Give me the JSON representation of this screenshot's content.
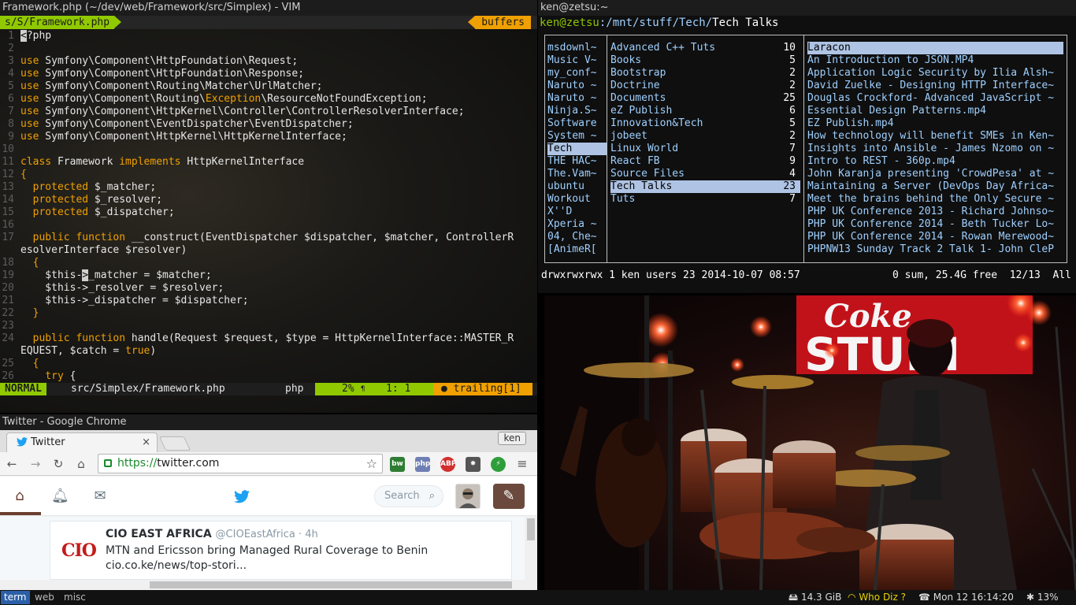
{
  "vim": {
    "title": "Framework.php (~/dev/web/Framework/src/Simplex) - VIM",
    "tab": "s/S/Framework.php",
    "buffers": "buffers",
    "lines": [
      {
        "n": "1",
        "t": "<?php"
      },
      {
        "n": "2",
        "t": ""
      },
      {
        "n": "3",
        "t": "use Symfony\\Component\\HttpFoundation\\Request;"
      },
      {
        "n": "4",
        "t": "use Symfony\\Component\\HttpFoundation\\Response;"
      },
      {
        "n": "5",
        "t": "use Symfony\\Component\\Routing\\Matcher\\UrlMatcher;"
      },
      {
        "n": "6",
        "t": "use Symfony\\Component\\Routing\\Exception\\ResourceNotFoundException;"
      },
      {
        "n": "7",
        "t": "use Symfony\\Component\\HttpKernel\\Controller\\ControllerResolverInterface;"
      },
      {
        "n": "8",
        "t": "use Symfony\\Component\\EventDispatcher\\EventDispatcher;"
      },
      {
        "n": "9",
        "t": "use Symfony\\Component\\HttpKernel\\HttpKernelInterface;"
      },
      {
        "n": "10",
        "t": ""
      },
      {
        "n": "11",
        "t": "class Framework implements HttpKernelInterface"
      },
      {
        "n": "12",
        "t": "{"
      },
      {
        "n": "13",
        "t": "  protected $_matcher;"
      },
      {
        "n": "14",
        "t": "  protected $_resolver;"
      },
      {
        "n": "15",
        "t": "  protected $_dispatcher;"
      },
      {
        "n": "16",
        "t": ""
      },
      {
        "n": "17",
        "t": "  public function __construct(EventDispatcher $dispatcher, $matcher, ControllerR"
      },
      {
        "n": "",
        "t": "esolverInterface $resolver)"
      },
      {
        "n": "18",
        "t": "  {"
      },
      {
        "n": "19",
        "t": "    $this->_matcher = $matcher;"
      },
      {
        "n": "20",
        "t": "    $this->_resolver = $resolver;"
      },
      {
        "n": "21",
        "t": "    $this->_dispatcher = $dispatcher;"
      },
      {
        "n": "22",
        "t": "  }"
      },
      {
        "n": "23",
        "t": ""
      },
      {
        "n": "24",
        "t": "  public function handle(Request $request, $type = HttpKernelInterface::MASTER_R"
      },
      {
        "n": "",
        "t": "EQUEST, $catch = true)"
      },
      {
        "n": "25",
        "t": "  {"
      },
      {
        "n": "26",
        "t": "    try {"
      }
    ],
    "status": {
      "mode": "NORMAL",
      "file": "src/Simplex/Framework.php",
      "filetype": "php",
      "percent": "2%",
      "position": "1:  1",
      "trailing": "● trailing[1]"
    }
  },
  "terminal": {
    "title": "ken@zetsu:~",
    "prompt_user": "ken@zetsu",
    "prompt_path": ":/mnt/stuff/Tech/",
    "prompt_dir": "Tech Talks",
    "col1": [
      "msdownl~",
      "Music V~",
      "my_conf~",
      "Naruto ~",
      "Naruto ~",
      "Ninja.S~",
      "Software",
      "System ~",
      "Tech",
      "THE HAC~",
      "The.Vam~",
      "ubuntu",
      "Workout",
      "X''D",
      "Xperia ~",
      "04, Che~",
      "[AnimeR["
    ],
    "col1_selected": 8,
    "col2": [
      {
        "name": "Advanced C++ Tuts",
        "count": "10"
      },
      {
        "name": "Books",
        "count": "5"
      },
      {
        "name": "Bootstrap",
        "count": "2"
      },
      {
        "name": "Doctrine",
        "count": "2"
      },
      {
        "name": "Documents",
        "count": "25"
      },
      {
        "name": "eZ Publish",
        "count": "6"
      },
      {
        "name": "Innovation&Tech",
        "count": "5"
      },
      {
        "name": "jobeet",
        "count": "2"
      },
      {
        "name": "Linux World",
        "count": "7"
      },
      {
        "name": "React FB",
        "count": "9"
      },
      {
        "name": "Source Files",
        "count": "4"
      },
      {
        "name": "Tech Talks",
        "count": "23"
      },
      {
        "name": "Tuts",
        "count": "7"
      }
    ],
    "col2_selected": 11,
    "col3": [
      "Laracon",
      "An Introduction to JSON.MP4",
      "Application Logic Security by Ilia Alsh~",
      "David Zuelke - Designing HTTP Interface~",
      "Douglas Crockford- Advanced JavaScript ~",
      "Essential Design Patterns.mp4",
      "EZ Publish.mp4",
      "How technology will benefit SMEs in Ken~",
      "Insights into Ansible - James Nzomo on ~",
      "Intro to REST - 360p.mp4",
      "John Karanja presenting 'CrowdPesa' at ~",
      "Maintaining a Server (DevOps Day Africa~",
      "Meet the brains behind the Only Secure ~",
      "PHP UK Conference 2013 - Richard Johnso~",
      "PHP UK Conference 2014 - Beth Tucker Lo~",
      "PHP UK Conference 2014 - Rowan Merewood~",
      "PHPNW13 Sunday Track 2 Talk 1- John CleP"
    ],
    "col3_selected": 0,
    "status_left": "drwxrwxrwx 1 ken users 23 2014-10-07 08:57",
    "status_right": "0 sum, 25.4G free  12/13  All"
  },
  "video": {
    "sign": "Coke STUDIO"
  },
  "chrome": {
    "title": "Twitter - Google Chrome",
    "tab_label": "Twitter",
    "tab_close": "×",
    "profile": "ken",
    "url_scheme": "https://",
    "url_host": "twitter.com",
    "extensions": [
      {
        "label": "bw",
        "color": "#2e7d32"
      },
      {
        "label": "php",
        "color": "#6f7fb5"
      },
      {
        "label": "ABP",
        "color": "#d32f2f"
      },
      {
        "label": "✸",
        "color": "#555555"
      },
      {
        "label": "⚡",
        "color": "#2e9e3a"
      }
    ],
    "search_placeholder": "Search",
    "tweet": {
      "logo": "CIO",
      "name": "CIO EAST AFRICA",
      "handle": "@CIOEastAfrica · 4h",
      "text_line1": "MTN and Ericsson bring Managed Rural Coverage to Benin",
      "text_line2": "cio.co.ke/news/top-stori..."
    }
  },
  "taskbar": {
    "tags": [
      "term",
      "web",
      "misc"
    ],
    "active_tag": 0,
    "disk": "14.3 GiB",
    "wifi": "Who Diz ?",
    "clock": "Mon 12 16:14:20",
    "volume": "13%"
  }
}
